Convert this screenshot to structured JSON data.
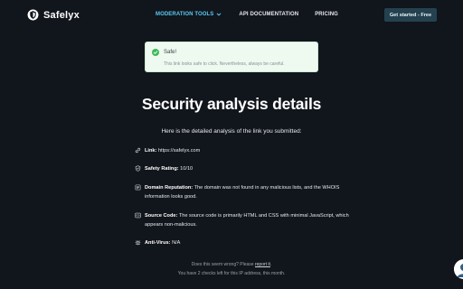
{
  "header": {
    "logo_text": "Safelyx",
    "nav": {
      "moderation_tools": "MODERATION TOOLS",
      "api_documentation": "API DOCUMENTATION",
      "pricing": "PRICING"
    },
    "cta_label": "Get started - Free"
  },
  "toast": {
    "title": "Safe!",
    "message": "This link looks safe to click. Nevertheless, always be careful.",
    "status_color": "#3fb95b"
  },
  "main": {
    "title": "Security analysis details",
    "intro": "Here is the detailed analysis of the link you submitted:",
    "details": [
      {
        "icon": "link-icon",
        "label": "Link:",
        "value": "https://safelyx.com"
      },
      {
        "icon": "shield-check-icon",
        "label": "Safety Rating:",
        "value": "10/10"
      },
      {
        "icon": "list-icon",
        "label": "Domain Reputation:",
        "value": "The domain was not found in any malicious lists, and the WHOIS information looks good."
      },
      {
        "icon": "code-icon",
        "label": "Source Code:",
        "value": "The source code is primarily HTML and CSS with minimal JavaScript, which appears non-malicious."
      },
      {
        "icon": "bug-icon",
        "label": "Anti-Virus:",
        "value": "N/A"
      }
    ]
  },
  "footer": {
    "wrong_prefix": "Does this seem wrong? Please",
    "report_link": "report it",
    "wrong_suffix": ".",
    "checks_left": "You have 2 checks left for this IP address, this month."
  },
  "colors": {
    "background": "#11151c",
    "accent": "#5cc8f2",
    "cta_background": "#24414f"
  }
}
